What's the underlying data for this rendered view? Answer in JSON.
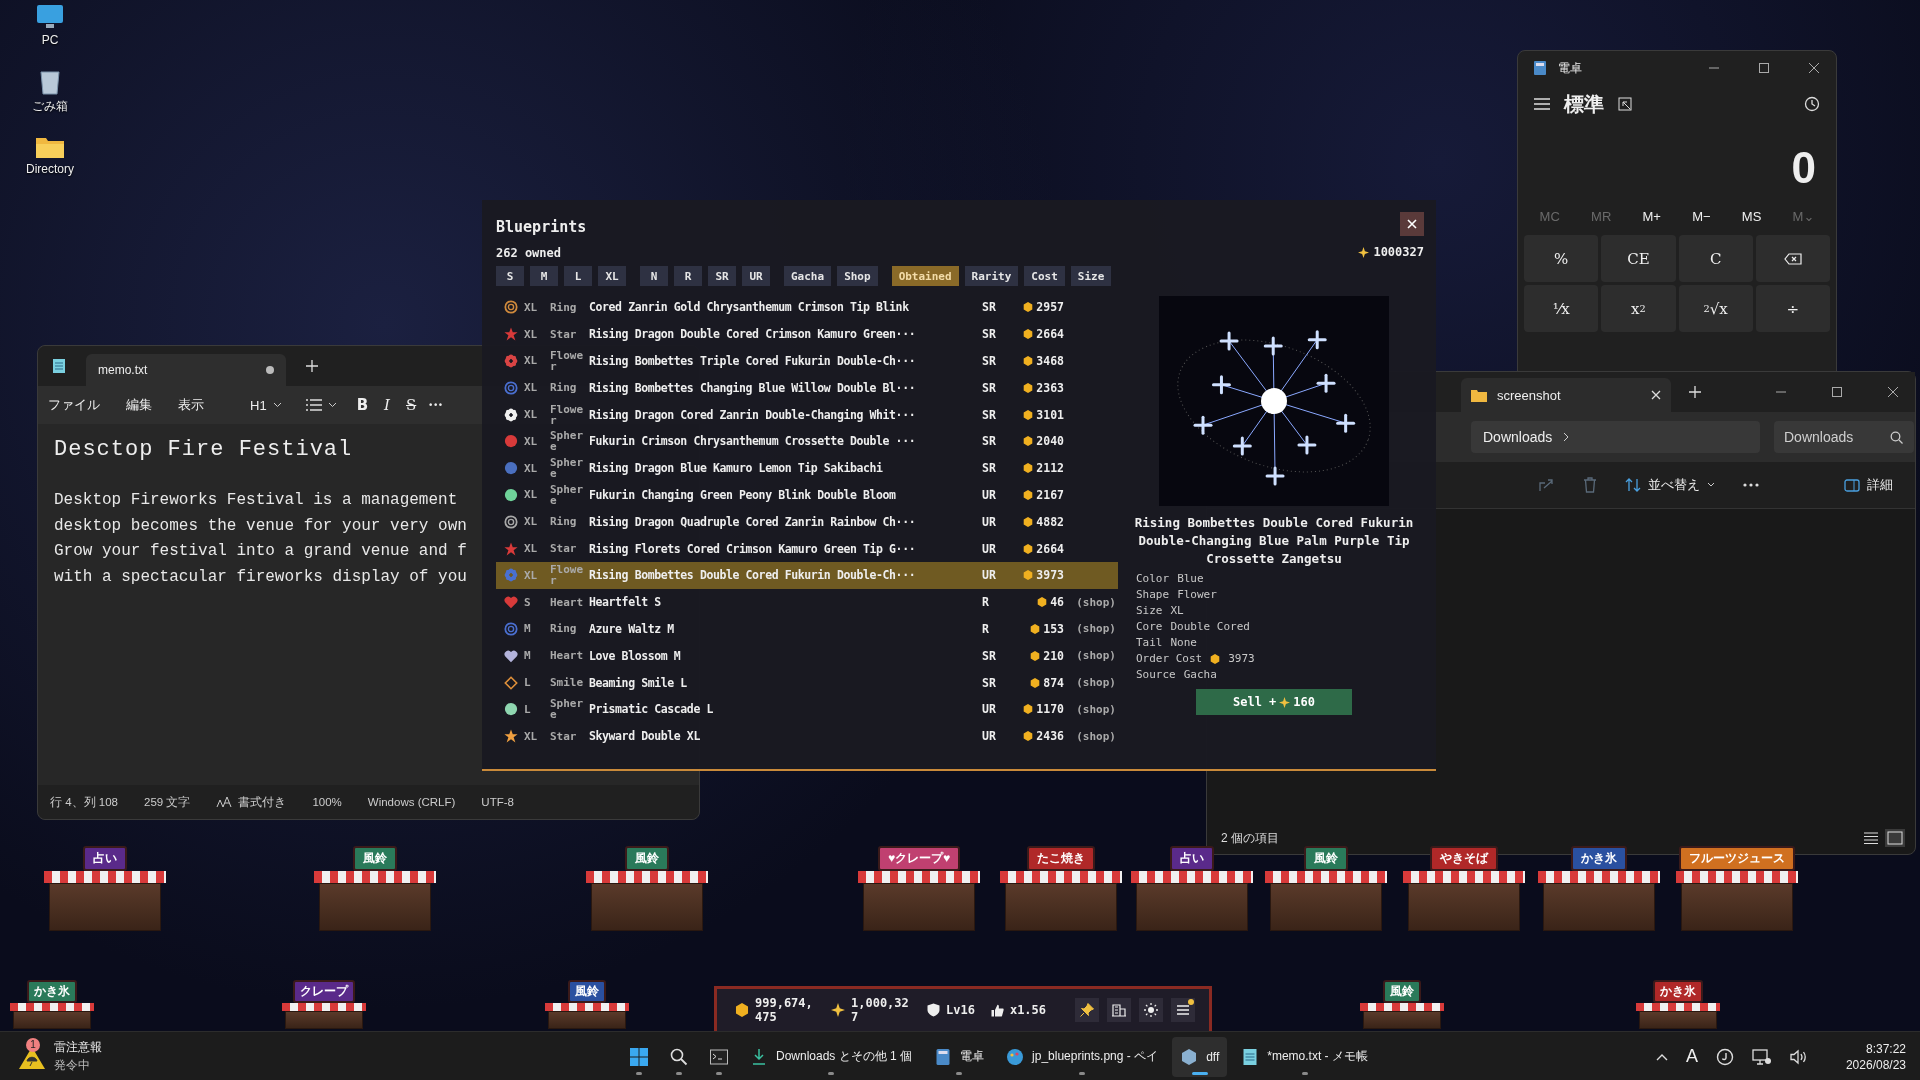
{
  "desktop_icons": [
    {
      "kind": "pc",
      "label": "PC"
    },
    {
      "kind": "bin",
      "label": "ごみ箱"
    },
    {
      "kind": "folder",
      "label": "Directory"
    }
  ],
  "notepad": {
    "tab": "memo.txt",
    "unsaved": true,
    "menu": [
      "ファイル",
      "編集",
      "表示"
    ],
    "heading_style": "H1",
    "format_buttons": [
      {
        "kind": "bold",
        "label": "B"
      },
      {
        "kind": "italic",
        "label": "I"
      },
      {
        "kind": "strike",
        "label": "S"
      },
      {
        "kind": "more",
        "label": "···"
      }
    ],
    "heading": "Desctop Fire Festival",
    "paragraph": [
      "Desktop Fireworks Festival is a management",
      "desktop becomes the venue for your very own",
      "Grow your festival into a grand venue and f",
      "with a spectacular fireworks display of you"
    ],
    "status": [
      {
        "kind": "position",
        "label": "行 4、列 108"
      },
      {
        "kind": "count",
        "label": "259 文字"
      },
      {
        "kind": "format",
        "label": "書式付き"
      },
      {
        "kind": "zoom",
        "label": "100%"
      },
      {
        "kind": "eol",
        "label": "Windows (CRLF)"
      },
      {
        "kind": "encoding",
        "label": "UTF-8"
      }
    ]
  },
  "calculator": {
    "title": "電卓",
    "mode": "標準",
    "display": "0",
    "memory": [
      {
        "label": "MC",
        "disabled": true
      },
      {
        "label": "MR",
        "disabled": true
      },
      {
        "label": "M+",
        "disabled": false
      },
      {
        "label": "M−",
        "disabled": false
      },
      {
        "label": "MS",
        "disabled": false
      },
      {
        "label": "M⌄",
        "disabled": true
      }
    ],
    "keys": [
      {
        "kind": "text",
        "label": "%"
      },
      {
        "kind": "text",
        "label": "CE"
      },
      {
        "kind": "text",
        "label": "C"
      },
      {
        "kind": "backspace"
      },
      {
        "kind": "text",
        "label": "⅟x"
      },
      {
        "kind": "text",
        "label": "x$^{2}$"
      },
      {
        "kind": "text",
        "label": "$^{2}$√x"
      },
      {
        "kind": "text",
        "label": "÷"
      }
    ]
  },
  "explorer": {
    "tab": "screenshot",
    "breadcrumb": "Downloads",
    "search_placeholder": "Downloads",
    "sort": "並べ替え",
    "details": "詳細",
    "item_count": "2 個の項目"
  },
  "blueprints": {
    "title": "Blueprints",
    "owned": "262 owned",
    "stars": "1000327",
    "filter_groups": [
      [
        {
          "label": "S",
          "selected": false
        },
        {
          "label": "M",
          "selected": false
        },
        {
          "label": "L",
          "selected": false
        },
        {
          "label": "XL",
          "selected": false
        }
      ],
      [
        {
          "label": "N",
          "selected": false
        },
        {
          "label": "R",
          "selected": false
        },
        {
          "label": "SR",
          "selected": false
        },
        {
          "label": "UR",
          "selected": false
        }
      ],
      [
        {
          "label": "Gacha",
          "selected": false
        },
        {
          "label": "Shop",
          "selected": false
        }
      ],
      [
        {
          "label": "Obtained",
          "selected": true
        },
        {
          "label": "Rarity",
          "selected": false
        },
        {
          "label": "Cost",
          "selected": false
        },
        {
          "label": "Size",
          "selected": false
        }
      ]
    ],
    "rows": [
      {
        "kind": "ring",
        "color": "#d08a3c",
        "size": "XL",
        "shape": "Ring",
        "name": "Cored Zanrin Gold Chrysanthemum Crimson Tip Blink",
        "rarity": "SR",
        "cost": "2957",
        "selected": false
      },
      {
        "kind": "star",
        "color": "#d83a3a",
        "size": "XL",
        "shape": "Star",
        "name": "Rising Dragon Double Cored Crimson Kamuro Green···",
        "rarity": "SR",
        "cost": "2664",
        "selected": false
      },
      {
        "kind": "flower",
        "color": "#d94444",
        "size": "XL",
        "shape": "Flower",
        "name": "Rising Bombettes Triple Cored Fukurin Double-Ch···",
        "rarity": "SR",
        "cost": "3468",
        "selected": false
      },
      {
        "kind": "ring",
        "color": "#4a6fd0",
        "size": "XL",
        "shape": "Ring",
        "name": "Rising Bombettes Changing Blue Willow Double Bl···",
        "rarity": "SR",
        "cost": "2363",
        "selected": false
      },
      {
        "kind": "flower",
        "color": "#f0f0f0",
        "size": "XL",
        "shape": "Flower",
        "name": "Rising Dragon Cored Zanrin Double-Changing Whit···",
        "rarity": "SR",
        "cost": "3101",
        "selected": false
      },
      {
        "kind": "circle",
        "color": "#d83a3a",
        "size": "XL",
        "shape": "Sphere",
        "name": "Fukurin Crimson Chrysanthemum Crossette Double ···",
        "rarity": "SR",
        "cost": "2040",
        "selected": false
      },
      {
        "kind": "circle",
        "color": "#4a6fbf",
        "size": "XL",
        "shape": "Sphere",
        "name": "Rising Dragon Blue Kamuro Lemon Tip Sakibachi",
        "rarity": "SR",
        "cost": "2112",
        "selected": false
      },
      {
        "kind": "circle",
        "color": "#6fd39a",
        "size": "XL",
        "shape": "Sphere",
        "name": "Fukurin Changing Green Peony Blink Double Bloom",
        "rarity": "UR",
        "cost": "2167",
        "selected": false
      },
      {
        "kind": "ring",
        "color": "#a8a8a8",
        "size": "XL",
        "shape": "Ring",
        "name": "Rising Dragon Quadruple Cored Zanrin Rainbow Ch···",
        "rarity": "UR",
        "cost": "4882",
        "selected": false
      },
      {
        "kind": "star",
        "color": "#d83a3a",
        "size": "XL",
        "shape": "Star",
        "name": "Rising Florets Cored Crimson Kamuro Green Tip G···",
        "rarity": "UR",
        "cost": "2664",
        "selected": false
      },
      {
        "kind": "flower",
        "color": "#4a70d0",
        "size": "XL",
        "shape": "Flower",
        "name": "Rising Bombettes Double Cored Fukurin Double-Ch···",
        "rarity": "UR",
        "cost": "3973",
        "selected": true
      },
      {
        "kind": "heart",
        "color": "#d83a3a",
        "size": "S",
        "shape": "Heart",
        "name": "Heartfelt S",
        "rarity": "R",
        "cost": "46",
        "note": "(shop)",
        "selected": false
      },
      {
        "kind": "ring",
        "color": "#4a6fd0",
        "size": "M",
        "shape": "Ring",
        "name": "Azure Waltz M",
        "rarity": "R",
        "cost": "153",
        "note": "(shop)",
        "selected": false
      },
      {
        "kind": "heart",
        "color": "#b4b4dc",
        "size": "M",
        "shape": "Heart",
        "name": "Love Blossom M",
        "rarity": "SR",
        "cost": "210",
        "note": "(shop)",
        "selected": false
      },
      {
        "kind": "diamond",
        "color": "#e0903a",
        "size": "L",
        "shape": "Smile",
        "name": "Beaming Smile L",
        "rarity": "SR",
        "cost": "874",
        "note": "(shop)",
        "selected": false
      },
      {
        "kind": "circle",
        "color": "#8fd6b0",
        "size": "L",
        "shape": "Sphere",
        "name": "Prismatic Cascade L",
        "rarity": "UR",
        "cost": "1170",
        "note": "(shop)",
        "selected": false
      },
      {
        "kind": "star",
        "color": "#f0a040",
        "size": "XL",
        "shape": "Star",
        "name": "Skyward Double XL",
        "rarity": "UR",
        "cost": "2436",
        "note": "(shop)",
        "selected": false
      }
    ],
    "detail": {
      "title": "Rising Bombettes Double Cored Fukurin Double-Changing Blue Palm Purple Tip Crossette Zangetsu",
      "props": [
        {
          "kind": "text",
          "key": "Color",
          "value": "Blue"
        },
        {
          "kind": "text",
          "key": "Shape",
          "value": "Flower"
        },
        {
          "kind": "text",
          "key": "Size",
          "value": "XL"
        },
        {
          "kind": "text",
          "key": "Core",
          "value": "Double Cored"
        },
        {
          "kind": "text",
          "key": "Tail",
          "value": "None"
        },
        {
          "kind": "cost",
          "key": "Order Cost",
          "value": "3973"
        },
        {
          "kind": "text",
          "key": "Source",
          "value": "Gacha"
        }
      ],
      "sell_label": "Sell +",
      "sell_value": "160"
    }
  },
  "game": {
    "stalls": [
      "占い",
      "風鈴",
      "風鈴",
      "♥クレープ♥",
      "たこ焼き",
      "占い",
      "風鈴",
      "やきそば",
      "かき氷",
      "フルーツジュース"
    ],
    "front_stalls": [
      "かき氷",
      "クレープ",
      "風鈴",
      "風鈴",
      "かき氷"
    ],
    "hud": {
      "coins": "999,674,475",
      "stars": "1,000,327",
      "level": "Lv16",
      "multiplier": "x1.56",
      "menu_badge": true
    }
  },
  "taskbar": {
    "weather": {
      "badge": "1",
      "title": "雷注意報",
      "subtitle": "発令中"
    },
    "apps": [
      {
        "kind": "start",
        "selected": false
      },
      {
        "kind": "search",
        "selected": false
      },
      {
        "kind": "terminal",
        "selected": false
      },
      {
        "kind": "downloads",
        "label": "Downloads とその他 1 個",
        "selected": false
      },
      {
        "kind": "calculator",
        "label": "電卓",
        "selected": false
      },
      {
        "kind": "paint",
        "label": "jp_blueprints.png - ペイ",
        "selected": false
      },
      {
        "kind": "dff",
        "label": "dff",
        "selected": true
      },
      {
        "kind": "notepad",
        "label": "*memo.txt - メモ帳",
        "selected": false
      }
    ],
    "ime": "A",
    "time": "8:37:22",
    "date": "2026/08/23"
  }
}
